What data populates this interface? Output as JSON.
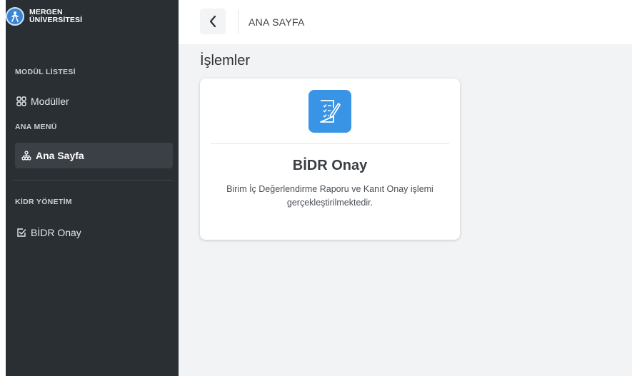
{
  "brand": {
    "line1": "MERGEN",
    "line2": "ÜNİVERSİTESİ"
  },
  "sidebar": {
    "sections": [
      {
        "title": "MODÜL LİSTESİ"
      },
      {
        "title": "ANA MENÜ"
      },
      {
        "title": "KİDR YÖNETİM"
      }
    ],
    "items": [
      {
        "label": "Modüller",
        "icon": "grid-icon"
      },
      {
        "label": "Ana Sayfa",
        "icon": "sitemap-icon",
        "active": true
      },
      {
        "label": "BİDR Onay",
        "icon": "checkbox-icon"
      }
    ]
  },
  "header": {
    "title": "ANA SAYFA"
  },
  "main": {
    "page_title": "İşlemler",
    "cards": [
      {
        "title": "BİDR Onay",
        "description": "Birim İç Değerlendirme Raporu ve Kanıt Onay işlemi gerçekleştirilmektedir.",
        "icon": "document-edit-icon"
      }
    ]
  },
  "colors": {
    "sidebar_bg": "#2a2f33",
    "sidebar_active": "#3a4045",
    "accent": "#3a94e6",
    "content_bg": "#f1f3f5"
  }
}
